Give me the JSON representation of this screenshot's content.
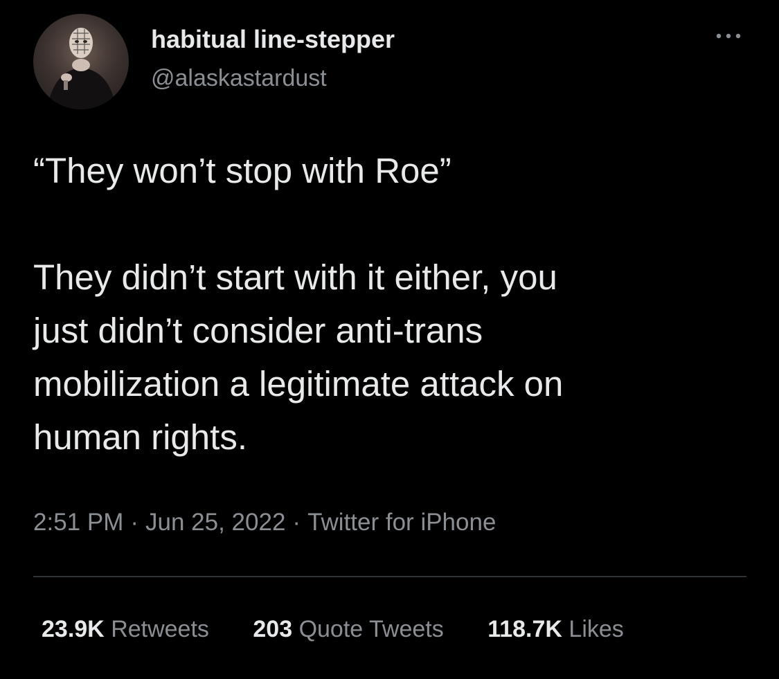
{
  "user": {
    "display_name": "habitual line-stepper",
    "handle": "@alaskastardust",
    "avatar_icon": "profile-avatar"
  },
  "header": {
    "more_icon": "more-options-icon"
  },
  "tweet": {
    "text": "“They won’t stop with Roe”\n\nThey didn’t start with it either, you\njust didn’t consider anti-trans\nmobilization a legitimate attack on\nhuman rights."
  },
  "meta": {
    "time": "2:51 PM",
    "date": "Jun 25, 2022",
    "source": "Twitter for iPhone",
    "separator": "·"
  },
  "stats": [
    {
      "count": "23.9K",
      "label": "Retweets"
    },
    {
      "count": "203",
      "label": "Quote Tweets"
    },
    {
      "count": "118.7K",
      "label": "Likes"
    }
  ],
  "colors": {
    "background": "#000000",
    "text": "#e7e9ea",
    "secondary_text": "#8b8f94",
    "divider": "#2f3336"
  }
}
